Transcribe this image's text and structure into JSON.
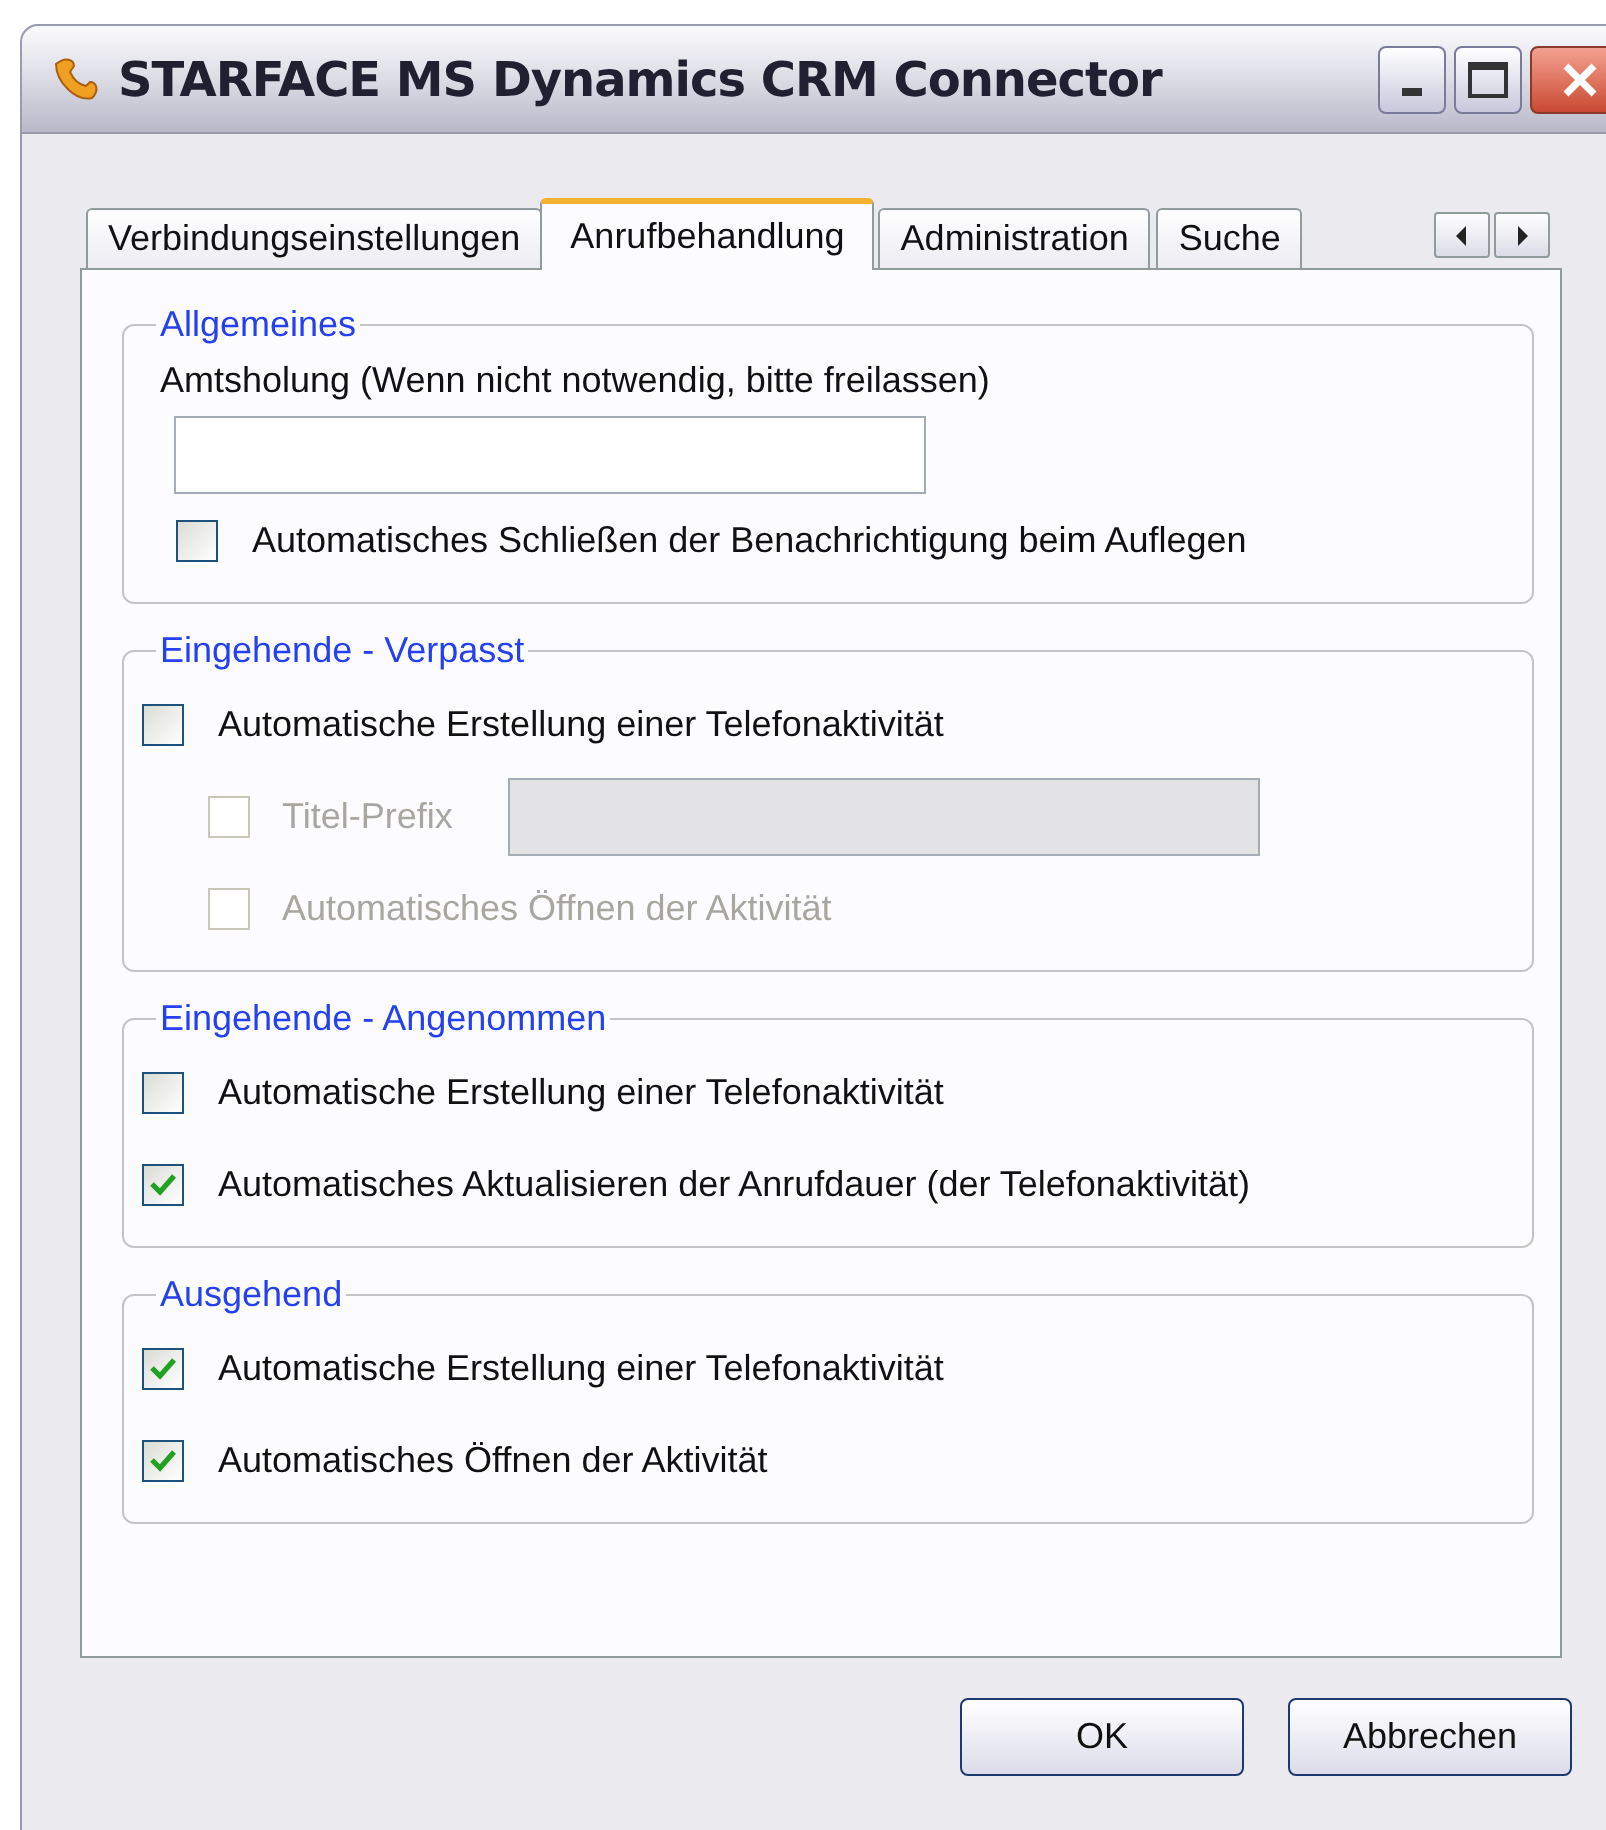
{
  "window": {
    "title": "STARFACE MS Dynamics CRM Connector"
  },
  "tabs": [
    {
      "label": "Verbindungseinstellungen",
      "selected": false
    },
    {
      "label": "Anrufbehandlung",
      "selected": true
    },
    {
      "label": "Administration",
      "selected": false
    },
    {
      "label": "Suche",
      "selected": false
    }
  ],
  "groups": [
    {
      "title": "Allgemeines",
      "items": [
        {
          "kind": "label",
          "text": "Amtsholung (Wenn nicht notwendig, bitte freilassen)"
        },
        {
          "kind": "text_field",
          "disabled": false
        },
        {
          "kind": "checkbox",
          "label": "Automatisches Schließen der Benachrichtigung beim Auflegen",
          "checked": false,
          "disabled": false
        }
      ]
    },
    {
      "title": "Eingehende - Verpasst",
      "items": [
        {
          "kind": "checkbox",
          "label": "Automatische Erstellung einer Telefonaktivität",
          "checked": false,
          "disabled": false,
          "children": [
            {
              "kind": "checkbox_field",
              "label": "Titel-Prefix",
              "checked": false,
              "disabled": true
            },
            {
              "kind": "checkbox",
              "label": "Automatisches Öffnen der Aktivität",
              "checked": false,
              "disabled": true
            }
          ]
        }
      ]
    },
    {
      "title": "Eingehende - Angenommen",
      "items": [
        {
          "kind": "checkbox",
          "label": "Automatische Erstellung einer Telefonaktivität",
          "checked": false,
          "disabled": false
        },
        {
          "kind": "checkbox",
          "label": "Automatisches Aktualisieren der Anrufdauer (der Telefonaktivität)",
          "checked": true,
          "disabled": false
        }
      ]
    },
    {
      "title": "Ausgehend",
      "items": [
        {
          "kind": "checkbox",
          "label": "Automatische Erstellung einer Telefonaktivität",
          "checked": true,
          "disabled": false
        },
        {
          "kind": "checkbox",
          "label": "Automatisches Öffnen der Aktivität",
          "checked": true,
          "disabled": false
        }
      ]
    }
  ],
  "buttons": [
    {
      "label": "OK"
    },
    {
      "label": "Abbrechen"
    }
  ]
}
